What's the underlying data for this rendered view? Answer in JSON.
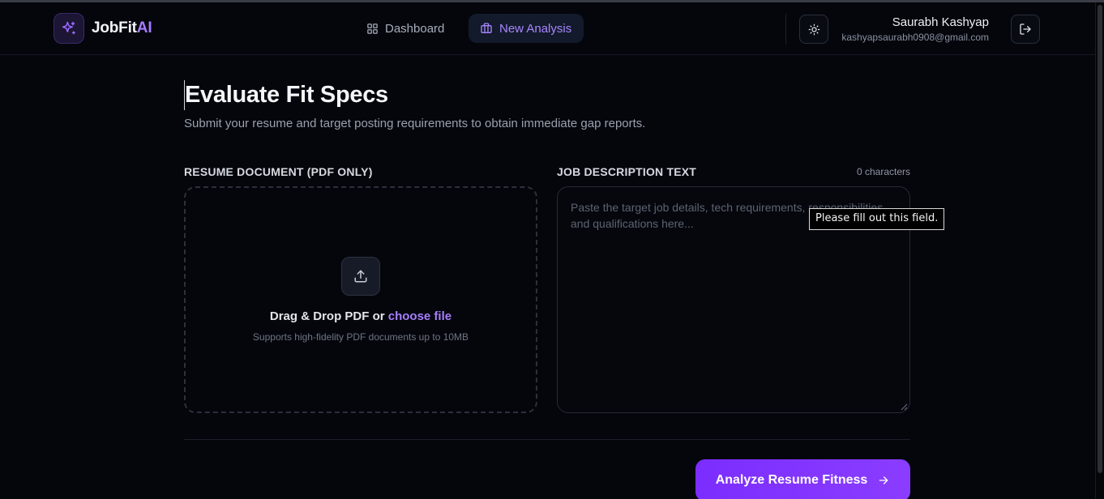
{
  "header": {
    "logo": {
      "text_main": "JobFit",
      "text_accent": "AI"
    },
    "nav": [
      {
        "label": "Dashboard",
        "icon": "grid-icon",
        "active": false
      },
      {
        "label": "New Analysis",
        "icon": "briefcase-icon",
        "active": true
      }
    ],
    "user": {
      "name": "Saurabh Kashyap",
      "email": "kashyapsaurabh0908@gmail.com"
    }
  },
  "page": {
    "title": "Evaluate Fit Specs",
    "subtitle": "Submit your resume and target posting requirements to obtain immediate gap reports."
  },
  "resume": {
    "label": "RESUME DOCUMENT (PDF ONLY)",
    "drop_text": "Drag & Drop PDF or ",
    "choose_text": "choose file",
    "hint": "Supports high-fidelity PDF documents up to 10MB"
  },
  "job": {
    "label": "JOB DESCRIPTION TEXT",
    "char_count": "0 characters",
    "placeholder": "Paste the target job details, tech requirements, responsibilities, and qualifications here...",
    "value": ""
  },
  "tooltip": {
    "text": "Please fill out this field."
  },
  "actions": {
    "analyze_label": "Analyze Resume Fitness"
  },
  "colors": {
    "accent": "#a87bff",
    "button": "#7b2dff",
    "background": "#04060c"
  }
}
